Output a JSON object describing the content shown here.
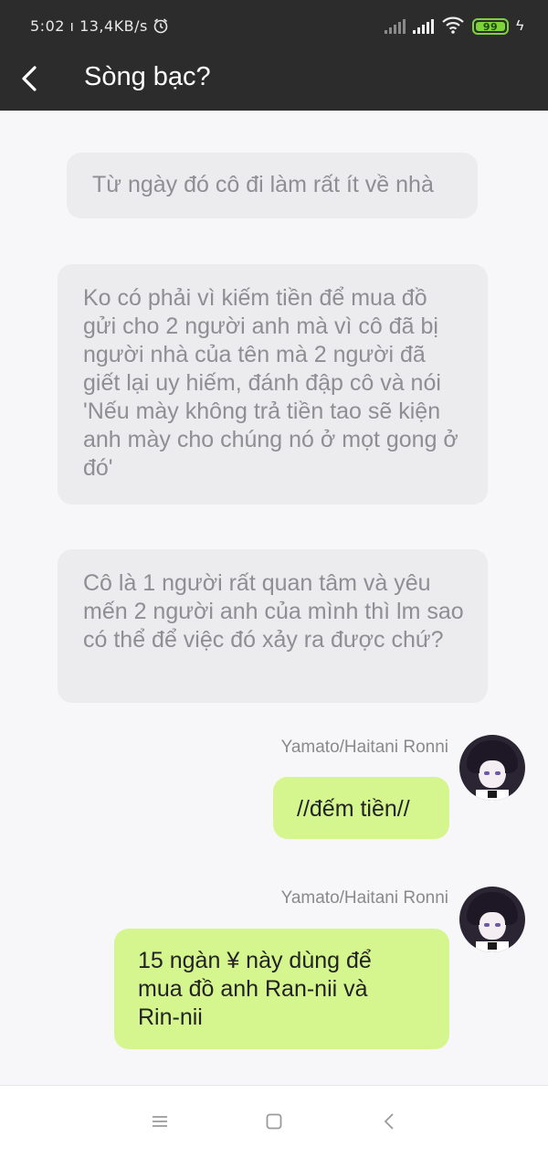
{
  "status_bar": {
    "time": "5:02",
    "speed": "13,4KB/s",
    "battery": "99",
    "icons": [
      "alarm-icon",
      "signal-icon",
      "wifi-icon",
      "battery-icon",
      "charging-icon"
    ]
  },
  "header": {
    "title": "Sòng bạc?",
    "back_icon": "chevron-left-icon"
  },
  "messages": [
    {
      "type": "narration",
      "text": "Từ ngày đó cô đi làm rất ít về nhà"
    },
    {
      "type": "narration",
      "text": "Ko có phải vì kiếm tiền để mua đồ gửi cho 2 người anh mà vì cô đã bị người nhà của tên mà 2 người đã giết lại uy hiếm, đánh đập cô và nói 'Nếu mày không trả tiền tao sẽ kiện anh mày cho chúng nó ở mọt gong ở đó'"
    },
    {
      "type": "narration",
      "text": "Cô là 1 người rất quan tâm và yêu mến 2 người anh của mình thì lm sao có thể để việc đó xảy ra được chứ?"
    },
    {
      "type": "character",
      "sender": "Yamato/Haitani Ronni",
      "text": "//đếm tiền//"
    },
    {
      "type": "character",
      "sender": "Yamato/Haitani Ronni",
      "text": "15 ngàn ¥ này dùng để mua đồ anh Ran-nii và Rin-nii"
    }
  ],
  "nav": {
    "icons": [
      "menu-icon",
      "home-square-icon",
      "back-triangle-icon"
    ]
  },
  "colors": {
    "header_bg": "#2c2c2c",
    "narration_bubble": "#ececee",
    "character_bubble": "#d5f68f",
    "page_bg": "#f7f7f9",
    "battery": "#7ed33a"
  }
}
